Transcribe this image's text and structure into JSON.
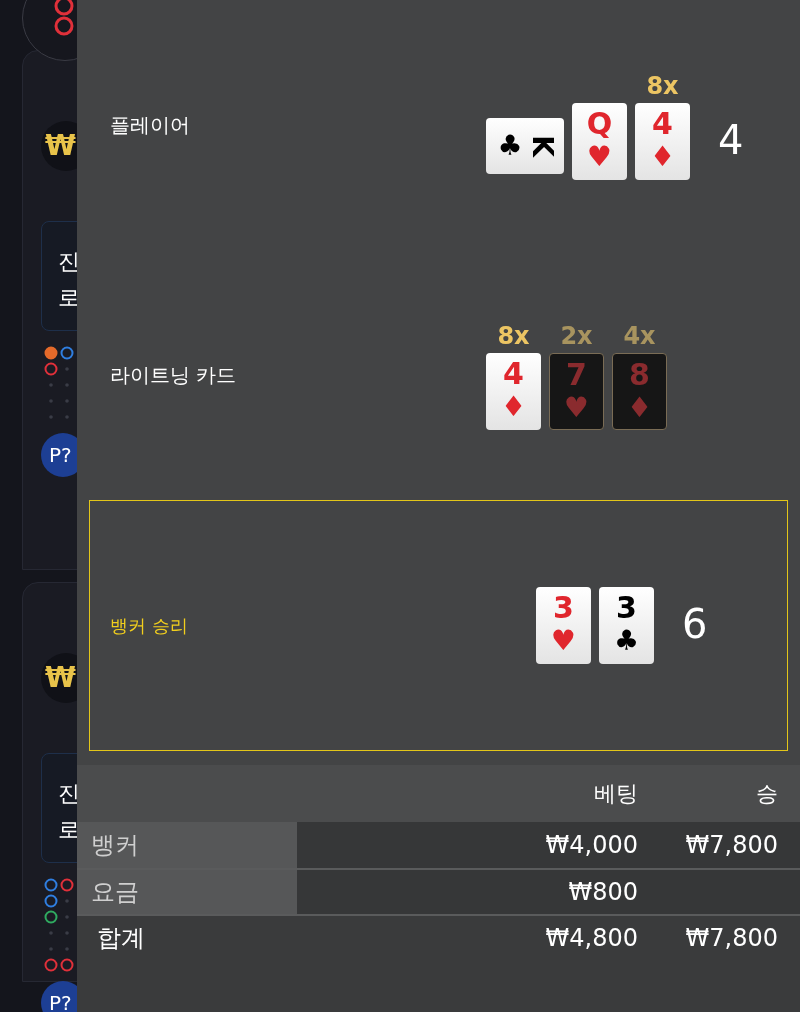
{
  "lobby": {
    "tables": [
      {
        "chip": "₩",
        "lines": [
          "진",
          "로"
        ],
        "button": "P?"
      },
      {
        "chip": "₩",
        "lines": [
          "진",
          "로"
        ],
        "button": "P?"
      }
    ]
  },
  "result": {
    "hands": [
      {
        "label": "플레이어",
        "winner": false,
        "total": "4",
        "cards": [
          {
            "rank": "K",
            "suit": "♣",
            "red": false,
            "rotated": true,
            "dark": false
          },
          {
            "rank": "Q",
            "suit": "♥",
            "red": true,
            "rotated": false,
            "dark": false
          },
          {
            "rank": "4",
            "suit": "♦",
            "red": true,
            "rotated": false,
            "dark": false,
            "multiplier": "8x"
          }
        ]
      },
      {
        "label": "라이트닝 카드",
        "winner": false,
        "cards": [
          {
            "rank": "4",
            "suit": "♦",
            "red": true,
            "rotated": false,
            "dark": false,
            "multiplier": "8x"
          },
          {
            "rank": "7",
            "suit": "♥",
            "red": true,
            "rotated": false,
            "dark": true,
            "multiplier": "2x"
          },
          {
            "rank": "8",
            "suit": "♦",
            "red": true,
            "rotated": false,
            "dark": true,
            "multiplier": "4x"
          }
        ]
      },
      {
        "label": "뱅커 승리",
        "winner": true,
        "total": "6",
        "cards": [
          {
            "rank": "3",
            "suit": "♥",
            "red": true,
            "rotated": false,
            "dark": false
          },
          {
            "rank": "3",
            "suit": "♣",
            "red": false,
            "rotated": false,
            "dark": false
          }
        ]
      }
    ],
    "table": {
      "columns": [
        "베팅",
        "승"
      ],
      "rows": [
        {
          "label": "뱅커",
          "bet": "₩4,000",
          "win": "₩7,800",
          "kind": "item"
        },
        {
          "label": "요금",
          "bet": "₩800",
          "kind": "item"
        },
        {
          "label": "합계",
          "bet": "₩4,800",
          "win": "₩7,800",
          "kind": "total"
        }
      ]
    }
  }
}
